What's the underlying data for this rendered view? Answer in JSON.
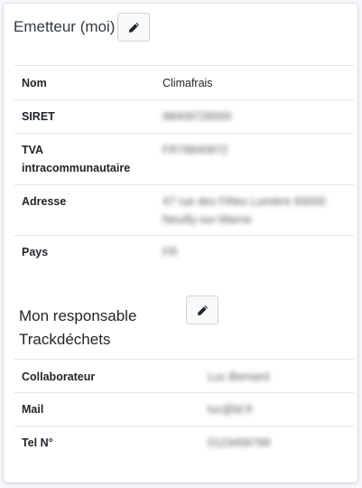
{
  "emitter": {
    "title": "Emetteur (moi)",
    "rows": [
      {
        "label": "Nom",
        "value": "Climafrais"
      },
      {
        "label": "SIRET",
        "value": "98409728000"
      },
      {
        "label": "TVA intracommunautaire",
        "value": "FR78840972"
      },
      {
        "label": "Adresse",
        "value": "47 rue des Fêtes Lumière 93000 Neuilly-sur-Marne"
      },
      {
        "label": "Pays",
        "value": "FR"
      }
    ]
  },
  "manager": {
    "title": "Mon responsable Trackdéchets",
    "rows": [
      {
        "label": "Collaborateur",
        "value": "Luc Bernard"
      },
      {
        "label": "Mail",
        "value": "luc@td.fr"
      },
      {
        "label": "Tel N°",
        "value": "0123456789"
      }
    ]
  },
  "icons": {
    "edit": "pencil-icon"
  },
  "colors": {
    "border": "#e3e6ea",
    "button_bg": "#f8f9fa"
  }
}
